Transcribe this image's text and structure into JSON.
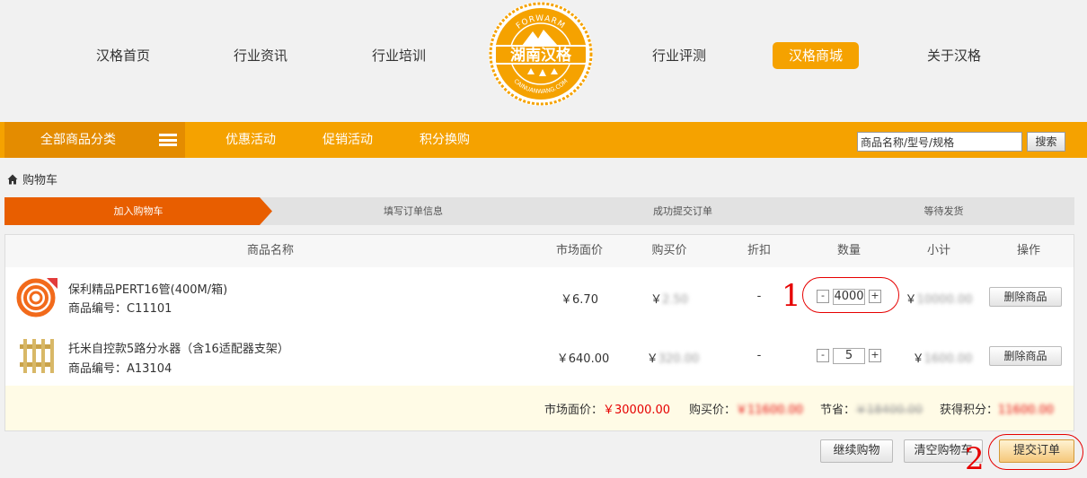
{
  "nav": {
    "items": [
      "汉格首页",
      "行业资讯",
      "行业培训",
      "行业评测",
      "汉格商城",
      "关于汉格"
    ],
    "active_index": 4
  },
  "logo": {
    "top_text": "FORWARM",
    "main_text": "湖南汉格",
    "bottom_text": "CAINUANWANG.COM"
  },
  "catbar": {
    "all_categories": "全部商品分类",
    "links": [
      "优惠活动",
      "促销活动",
      "积分换购"
    ],
    "search_value": "商品名称/型号/规格",
    "search_button": "搜索"
  },
  "breadcrumb": "购物车",
  "steps": [
    "加入购物车",
    "填写订单信息",
    "成功提交订单",
    "等待发货"
  ],
  "table": {
    "headers": [
      "商品名称",
      "市场面价",
      "购买价",
      "折扣",
      "数量",
      "小计",
      "操作"
    ],
    "rows": [
      {
        "name": "保利精品PERT16管(400M/箱)",
        "code": "商品编号：C11101",
        "market_price": "￥6.70",
        "buy_price_symbol": "￥",
        "buy_price": "2.50",
        "discount": "-",
        "qty": "4000",
        "subtotal_symbol": "￥",
        "subtotal": "10000.00",
        "action": "删除商品"
      },
      {
        "name": "托米自控款5路分水器（含16适配器支架）",
        "code": "商品编号：A13104",
        "market_price": "￥640.00",
        "buy_price_symbol": "￥",
        "buy_price": "320.00",
        "discount": "-",
        "qty": "5",
        "subtotal_symbol": "￥",
        "subtotal": "1600.00",
        "action": "删除商品"
      }
    ],
    "qty_minus": "-",
    "qty_plus": "+",
    "summary": {
      "market_label": "市场面价：",
      "market_value": "￥30000.00",
      "buy_label": "购买价：",
      "buy_value": "￥11600.00",
      "save_label": "节省：",
      "save_value": "￥18400.00",
      "points_label": "获得积分：",
      "points_value": "11600.00"
    }
  },
  "buttons": {
    "continue": "继续购物",
    "clear": "清空购物车",
    "submit": "提交订单"
  },
  "annotations": [
    "1",
    "2"
  ],
  "colors": {
    "accent": "#f5a200",
    "accent_dark": "#e48c00",
    "step_active": "#e85e00",
    "annotation": "#e60000"
  }
}
